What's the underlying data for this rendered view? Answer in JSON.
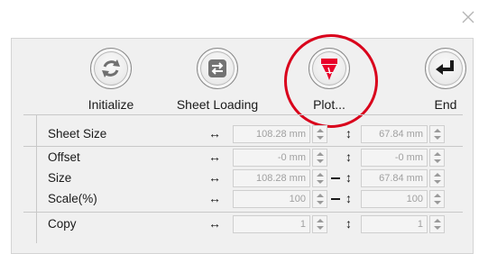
{
  "toolbar": {
    "initialize_label": "Initialize",
    "sheet_loading_label": "Sheet Loading",
    "plot_label": "Plot...",
    "end_label": "End"
  },
  "properties": [
    {
      "label": "Sheet Size",
      "h_value": "108.28 mm",
      "v_value": "67.84 mm",
      "linked": false
    },
    {
      "label": "Offset",
      "h_value": "-0 mm",
      "v_value": "-0 mm",
      "linked": false
    },
    {
      "label": "Size",
      "h_value": "108.28 mm",
      "v_value": "67.84 mm",
      "linked": true
    },
    {
      "label": "Scale(%)",
      "h_value": "100",
      "v_value": "100",
      "linked": true
    },
    {
      "label": "Copy",
      "h_value": "1",
      "v_value": "1",
      "linked": false
    }
  ],
  "icons": {
    "h_arrow": "↔",
    "v_arrow": "↕"
  },
  "colors": {
    "highlight": "#d9001b",
    "plot_icon": "#e8002a"
  }
}
